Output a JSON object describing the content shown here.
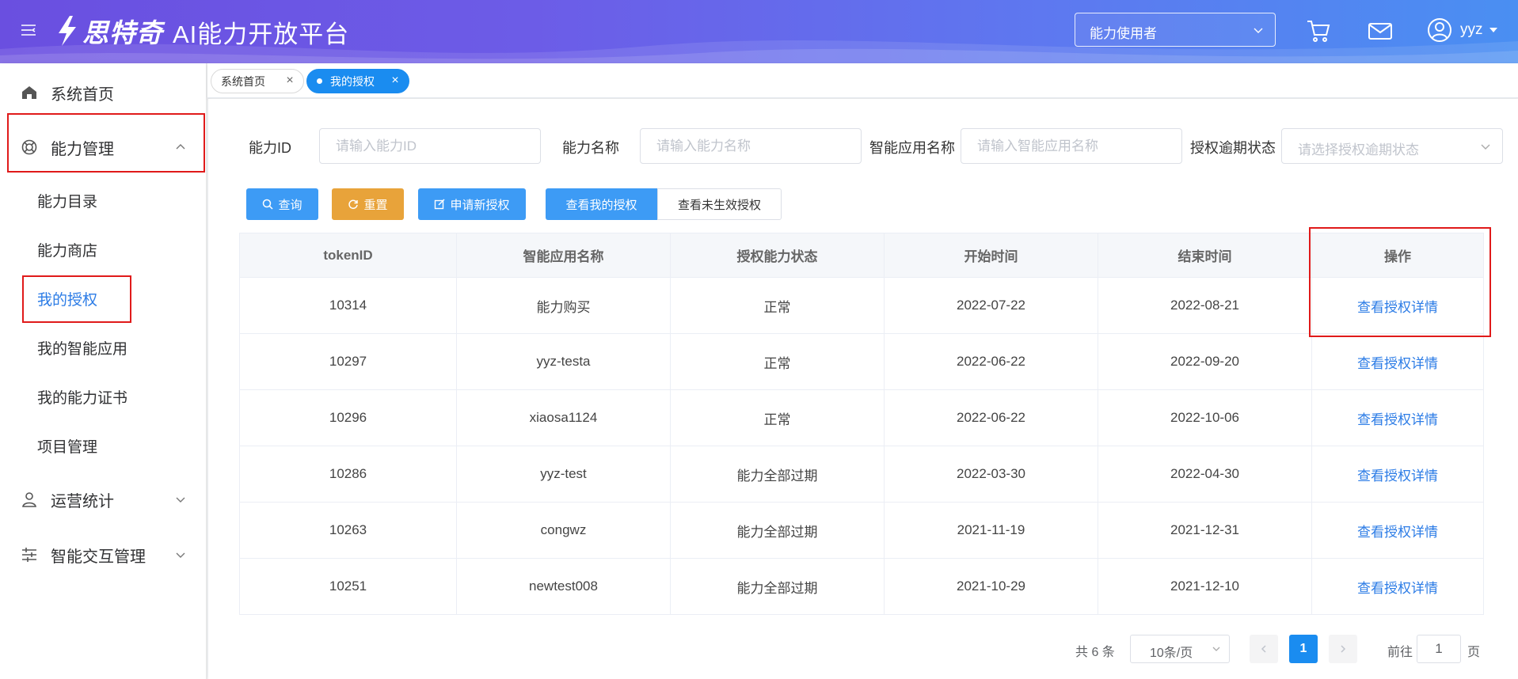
{
  "header": {
    "brand": "思特奇",
    "platform_title": "AI能力开放平台",
    "role_select_value": "能力使用者",
    "username": "yyz"
  },
  "sidebar": {
    "home": "系统首页",
    "ability_mgmt": "能力管理",
    "sub_items": [
      "能力目录",
      "能力商店",
      "我的授权",
      "我的智能应用",
      "我的能力证书",
      "项目管理"
    ],
    "ops_stats": "运营统计",
    "interaction_mgmt": "智能交互管理"
  },
  "tabs": [
    {
      "label": "系统首页",
      "active": false
    },
    {
      "label": "我的授权",
      "active": true
    }
  ],
  "filters": {
    "ability_id": {
      "label": "能力ID",
      "placeholder": "请输入能力ID"
    },
    "ability_name": {
      "label": "能力名称",
      "placeholder": "请输入能力名称"
    },
    "app_name": {
      "label": "智能应用名称",
      "placeholder": "请输入智能应用名称"
    },
    "expiry_status": {
      "label": "授权逾期状态",
      "placeholder": "请选择授权逾期状态"
    }
  },
  "buttons": {
    "query": "查询",
    "reset": "重置",
    "apply": "申请新授权",
    "view_mine": "查看我的授权",
    "view_inactive": "查看未生效授权"
  },
  "table": {
    "columns": [
      "tokenID",
      "智能应用名称",
      "授权能力状态",
      "开始时间",
      "结束时间",
      "操作"
    ],
    "rows": [
      {
        "token": "10314",
        "app": "能力购买",
        "status": "正常",
        "start": "2022-07-22",
        "end": "2022-08-21",
        "action": "查看授权详情"
      },
      {
        "token": "10297",
        "app": "yyz-testa",
        "status": "正常",
        "start": "2022-06-22",
        "end": "2022-09-20",
        "action": "查看授权详情"
      },
      {
        "token": "10296",
        "app": "xiaosa1124",
        "status": "正常",
        "start": "2022-06-22",
        "end": "2022-10-06",
        "action": "查看授权详情"
      },
      {
        "token": "10286",
        "app": "yyz-test",
        "status": "能力全部过期",
        "start": "2022-03-30",
        "end": "2022-04-30",
        "action": "查看授权详情"
      },
      {
        "token": "10263",
        "app": "congwz",
        "status": "能力全部过期",
        "start": "2021-11-19",
        "end": "2021-12-31",
        "action": "查看授权详情"
      },
      {
        "token": "10251",
        "app": "newtest008",
        "status": "能力全部过期",
        "start": "2021-10-29",
        "end": "2021-12-10",
        "action": "查看授权详情"
      }
    ]
  },
  "pagination": {
    "total": "共 6 条",
    "page_size": "10条/页",
    "current_page": "1",
    "goto_label": "前往",
    "goto_value": "1",
    "goto_unit": "页"
  },
  "colors": {
    "primary": "#1a8cf0",
    "link": "#2c7ce6",
    "reset_button": "#e8a33a",
    "highlight_box": "#e01a1a"
  },
  "icons": {
    "menu_toggle": "hamburger-icon",
    "cart": "cart-icon",
    "mail": "mail-icon",
    "user": "user-avatar-icon",
    "home": "home-icon",
    "ability": "ability-icon",
    "ops": "user-stats-icon",
    "interaction": "sliders-icon"
  }
}
